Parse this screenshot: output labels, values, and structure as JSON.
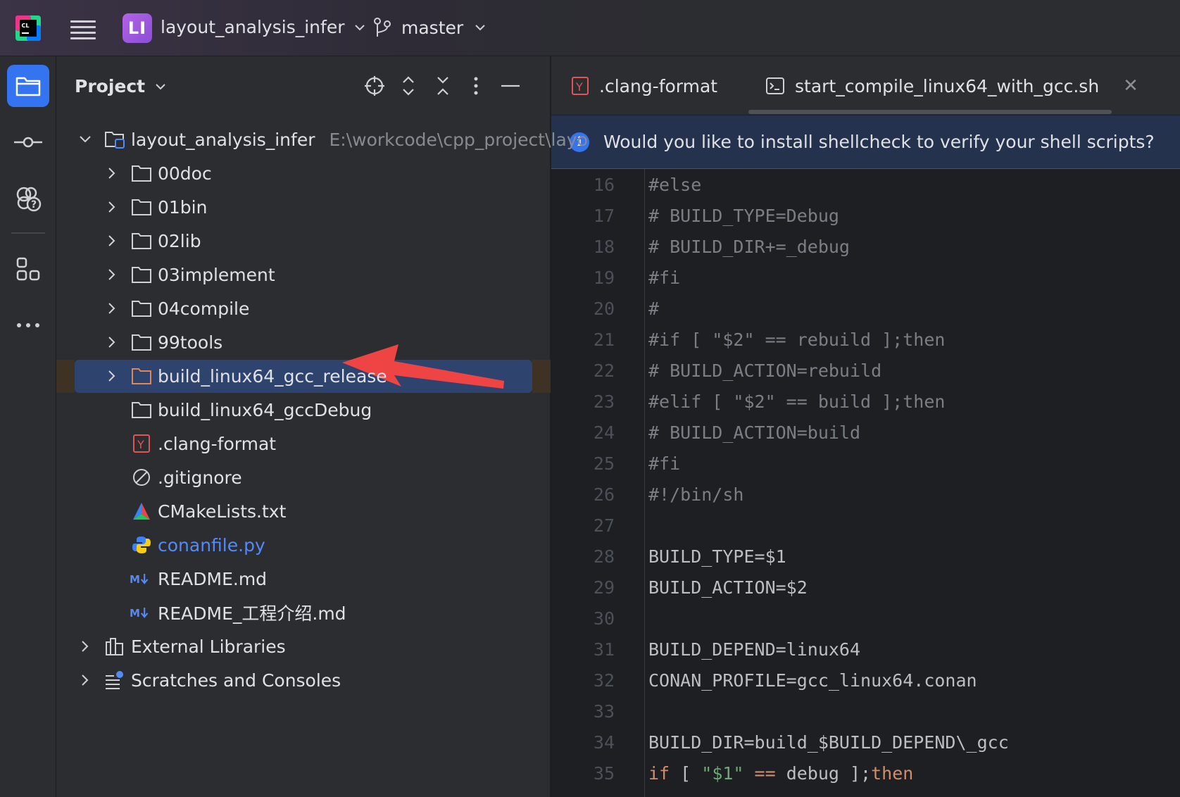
{
  "titlebar": {
    "project_badge": "LI",
    "project_name": "layout_analysis_infer",
    "branch": "master"
  },
  "stripe": {
    "buttons": [
      "project-tool",
      "commit-tool",
      "learn-tool",
      "structure-tool",
      "more-tools"
    ]
  },
  "panel": {
    "title": "Project",
    "tools": [
      "locate-icon",
      "expand-all-icon",
      "collapse-all-icon",
      "options-icon",
      "hide-icon"
    ]
  },
  "tree": {
    "root": {
      "label": "layout_analysis_infer",
      "path": "E:\\workcode\\cpp_project\\layo"
    },
    "items": [
      {
        "label": "00doc"
      },
      {
        "label": "01bin"
      },
      {
        "label": "02lib"
      },
      {
        "label": "03implement"
      },
      {
        "label": "04compile"
      },
      {
        "label": "99tools"
      },
      {
        "label": "build_linux64_gcc_release"
      },
      {
        "label": "build_linux64_gccDebug"
      },
      {
        "label": ".clang-format"
      },
      {
        "label": ".gitignore"
      },
      {
        "label": "CMakeLists.txt"
      },
      {
        "label": "conanfile.py"
      },
      {
        "label": "README.md"
      },
      {
        "label": "README_工程介绍.md"
      },
      {
        "label": "External Libraries"
      },
      {
        "label": "Scratches and Consoles"
      }
    ]
  },
  "editor": {
    "tabs": [
      {
        "label": ".clang-format"
      },
      {
        "label": "start_compile_linux64_with_gcc.sh"
      }
    ],
    "banner": "Would you like to install shellcheck to verify your shell scripts?",
    "lines": [
      {
        "n": "16",
        "text": "#else"
      },
      {
        "n": "17",
        "text": "# BUILD_TYPE=Debug"
      },
      {
        "n": "18",
        "text": "# BUILD_DIR+=_debug"
      },
      {
        "n": "19",
        "text": "#fi"
      },
      {
        "n": "20",
        "text": "#"
      },
      {
        "n": "21",
        "text": "#if [ \"$2\" == rebuild ];then"
      },
      {
        "n": "22",
        "text": "# BUILD_ACTION=rebuild"
      },
      {
        "n": "23",
        "text": "#elif [ \"$2\" == build ];then"
      },
      {
        "n": "24",
        "text": "# BUILD_ACTION=build"
      },
      {
        "n": "25",
        "text": "#fi"
      },
      {
        "n": "26",
        "text": "#!/bin/sh"
      },
      {
        "n": "27",
        "text": ""
      },
      {
        "n": "28",
        "text": "BUILD_TYPE=$1"
      },
      {
        "n": "29",
        "text": "BUILD_ACTION=$2"
      },
      {
        "n": "30",
        "text": ""
      },
      {
        "n": "31",
        "text": "BUILD_DEPEND=linux64"
      },
      {
        "n": "32",
        "text": "CONAN_PROFILE=gcc_linux64.conan"
      },
      {
        "n": "33",
        "text": ""
      },
      {
        "n": "34",
        "text": "BUILD_DIR=build_$BUILD_DEPEND\\_gcc"
      },
      {
        "n": "35",
        "text": "if [ \"$1\" == debug ];then"
      }
    ],
    "line35_parts": {
      "kw1": "if",
      "sp1": " [ ",
      "str": "\"$1\"",
      "op": " == ",
      "plain": "debug ];",
      "kw2": "then"
    }
  },
  "colors": {
    "accent": "#3574f0",
    "selection": "#2e436e",
    "annotation_arrow": "#ef4444"
  }
}
